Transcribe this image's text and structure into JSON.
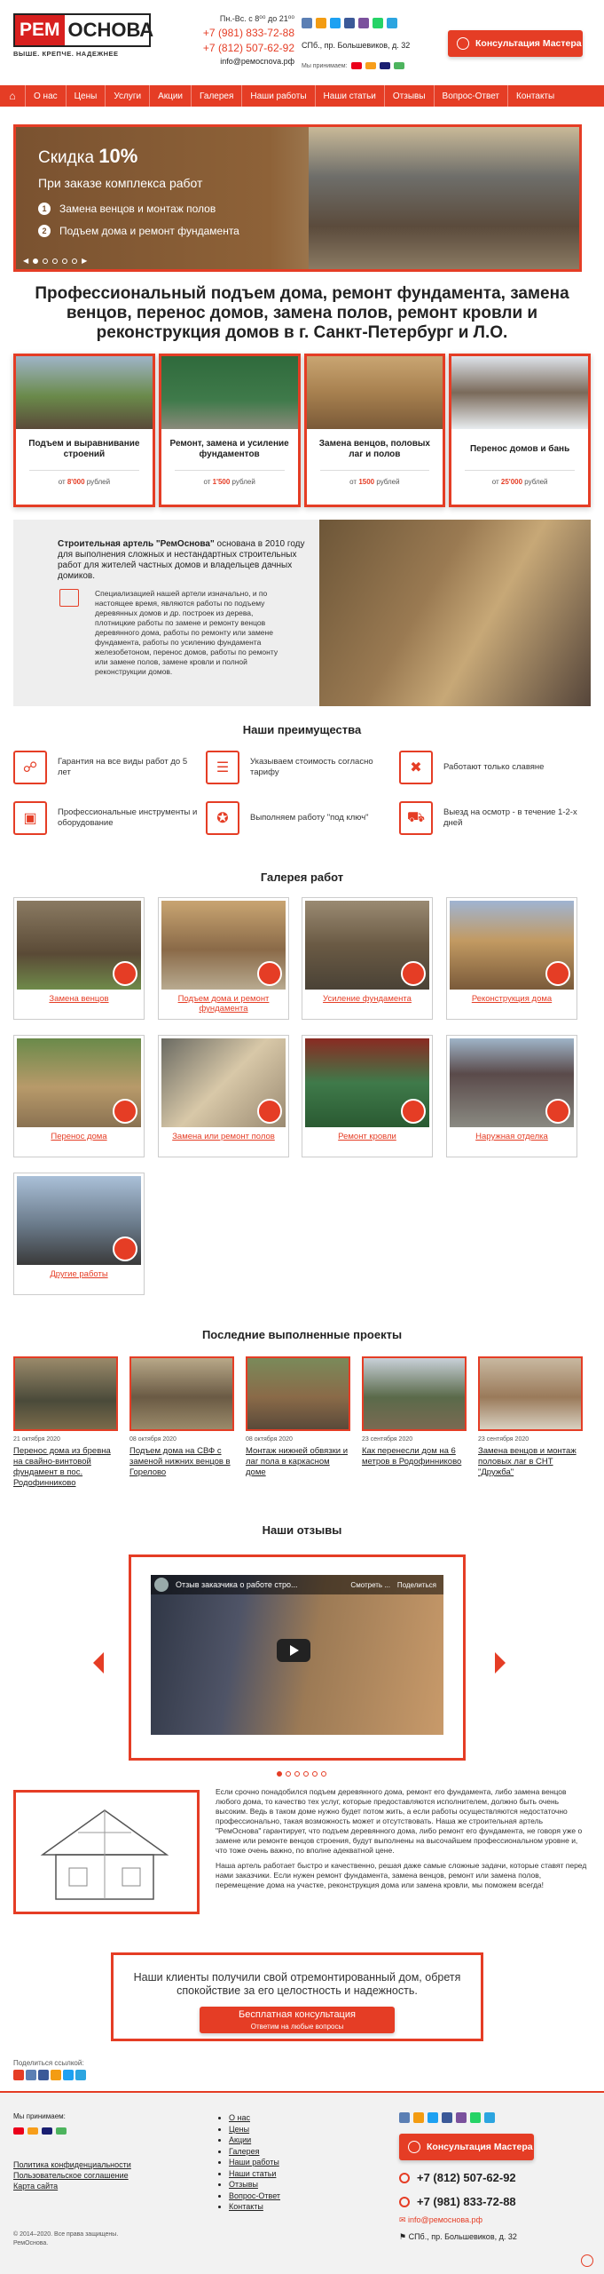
{
  "logo": {
    "rem": "РЕМ",
    "osn": "ОСНОВА",
    "slogan": "ВЫШЕ. КРЕПЧЕ. НАДЕЖНЕЕ"
  },
  "header": {
    "hours": "Пн.-Вс. с 8⁰⁰ до 21⁰⁰",
    "phone1": "+7 (981) 833-72-88",
    "phone2": "+7 (812) 507-62-92",
    "email": "info@ремосnova.рф",
    "address": "СПб., пр. Большевиков, д. 32",
    "pay_label": "Мы принимаем:",
    "consult_button": "Консультация Мастера",
    "social_colors": [
      "#5b7fb4",
      "#f39c12",
      "#1da1f2",
      "#3b5998",
      "#7b519d",
      "#25d366",
      "#2ca5e0"
    ]
  },
  "nav": {
    "items": [
      "О нас",
      "Цены",
      "Услуги",
      "Акции",
      "Галерея",
      "Наши работы",
      "Наши статьи",
      "Отзывы",
      "Вопрос-Ответ",
      "Контакты"
    ]
  },
  "slider": {
    "line1a": "Скидка ",
    "line1b": "10%",
    "line2": "При заказе комплекса работ",
    "items": [
      "Замена венцов и монтаж полов",
      "Подъем дома и ремонт фундамента"
    ]
  },
  "h1": "Профессиональный подъем дома, ремонт фундамента, замена венцов, перенос домов, замена полов, ремонт кровли и реконструкция домов в г. Санкт-Петербург и Л.О.",
  "services": [
    {
      "title": "Подъем и выравнивание строений",
      "price_prefix": "от ",
      "price": "8'000",
      "price_suffix": " рублей"
    },
    {
      "title": "Ремонт, замена и усиление фундаментов",
      "price_prefix": "от ",
      "price": "1'500",
      "price_suffix": " рублей"
    },
    {
      "title": "Замена венцов, половых лаг и полов",
      "price_prefix": "от ",
      "price": "1500",
      "price_suffix": " рублей"
    },
    {
      "title": "Перенос домов и бань",
      "price_prefix": "от ",
      "price": "25'000",
      "price_suffix": " рублей"
    }
  ],
  "about": {
    "lead_bold": "Строительная артель \"РемОснова\"",
    "lead_rest": " основана в 2010 году для выполнения сложных и нестандартных строительных работ для жителей частных домов и владельцев дачных домиков.",
    "text": "Специализацией нашей артели изначально, и по настоящее время, являются работы по подъему деревянных домов и др. построек из дерева, плотницкие работы по замене и ремонту венцов деревянного дома, работы по ремонту или замене фундамента, работы по усилению фундамента железобетоном, перенос домов, работы по ремонту или замене полов, замене кровли и полной реконструкции домов."
  },
  "advantages": {
    "title": "Наши преимущества",
    "items": [
      "Гарантия на все виды работ до 5 лет",
      "Указываем стоимость согласно тарифу",
      "Работают только славяне",
      "Профессиональные инструменты и оборудование",
      "Выполняем работу \"под ключ\"",
      "Выезд на осмотр - в течение 1-2-х дней"
    ]
  },
  "gallery": {
    "title": "Галерея работ",
    "items": [
      "Замена венцов",
      "Подъем дома и ремонт фундамента",
      "Усиление фундамента",
      "Реконструкция дома",
      "Перенос дома",
      "Замена или ремонт полов",
      "Ремонт кровли",
      "Наружная отделка",
      "Другие работы"
    ]
  },
  "projects": {
    "title": "Последние выполненные проекты",
    "items": [
      {
        "date": "21 октября 2020",
        "title": "Перенос дома из бревна на свайно-винтовой фундамент в пос. Родофинниково"
      },
      {
        "date": "08 октября 2020",
        "title": "Подъем дома на СВФ с заменой нижних венцов в Горелово"
      },
      {
        "date": "08 октября 2020",
        "title": "Монтаж нижней обвязки и лаг пола в каркасном доме"
      },
      {
        "date": "23 сентября 2020",
        "title": "Как перенесли дом на 6 метров в Родофинниково"
      },
      {
        "date": "23 сентября 2020",
        "title": "Замена венцов и монтаж половых лаг в СНТ \"Дружба\""
      }
    ]
  },
  "reviews": {
    "title": "Наши отзывы",
    "video_title": "Отзыв заказчика о работе стро...",
    "watch_later": "Смотреть ...",
    "share": "Поделиться"
  },
  "bottom_text": [
    "Если срочно понадобился подъем деревянного дома, ремонт его фундамента, либо замена венцов любого дома, то качество тех услуг, которые предоставляются исполнителем, должно быть очень высоким. Ведь в таком доме нужно будет потом жить, а если работы осуществляются недостаточно профессионально, такая возможность может и отсутствовать. Наша же строительная артель \"РемОснова\" гарантирует, что подъем деревянного дома, либо ремонт его фундамента, не говоря уже о замене или ремонте венцов строения, будут выполнены на высочайшем профессиональном уровне и, что тоже очень важно, по вполне адекватной цене.",
    "Наша артель работает быстро и качественно, решая даже самые сложные задачи, которые ставят перед нами заказчики. Если нужен ремонт фундамента, замена венцов, ремонт или замена полов, перемещение дома на участке, реконструкция дома или замена кровли, мы поможем всегда!"
  ],
  "cta": {
    "text": "Наши клиенты получили свой отремонтированный дом, обретя спокойствие за его целостность и надежность.",
    "button": "Бесплатная консультация",
    "button_sub": "Ответим на любые вопросы"
  },
  "share_label": "Поделиться ссылкой:",
  "footer": {
    "accept": "Мы принимаем:",
    "links": [
      "Политика конфиденциальности",
      "Пользовательское соглашение",
      "Карта сайта"
    ],
    "menu": [
      "О нас",
      "Цены",
      "Акции",
      "Галерея",
      "Наши работы",
      "Наши статьи",
      "Отзывы",
      "Вопрос-Ответ",
      "Контакты"
    ],
    "button": "Консультация Мастера",
    "phone1": "+7 (812) 507-62-92",
    "phone2": "+7 (981) 833-72-88",
    "email": "info@ремоснова.рф",
    "address": "СПб., пр. Большевиков, д. 32",
    "copyright": "© 2014–2020. Все права защищены. РемОснова."
  }
}
